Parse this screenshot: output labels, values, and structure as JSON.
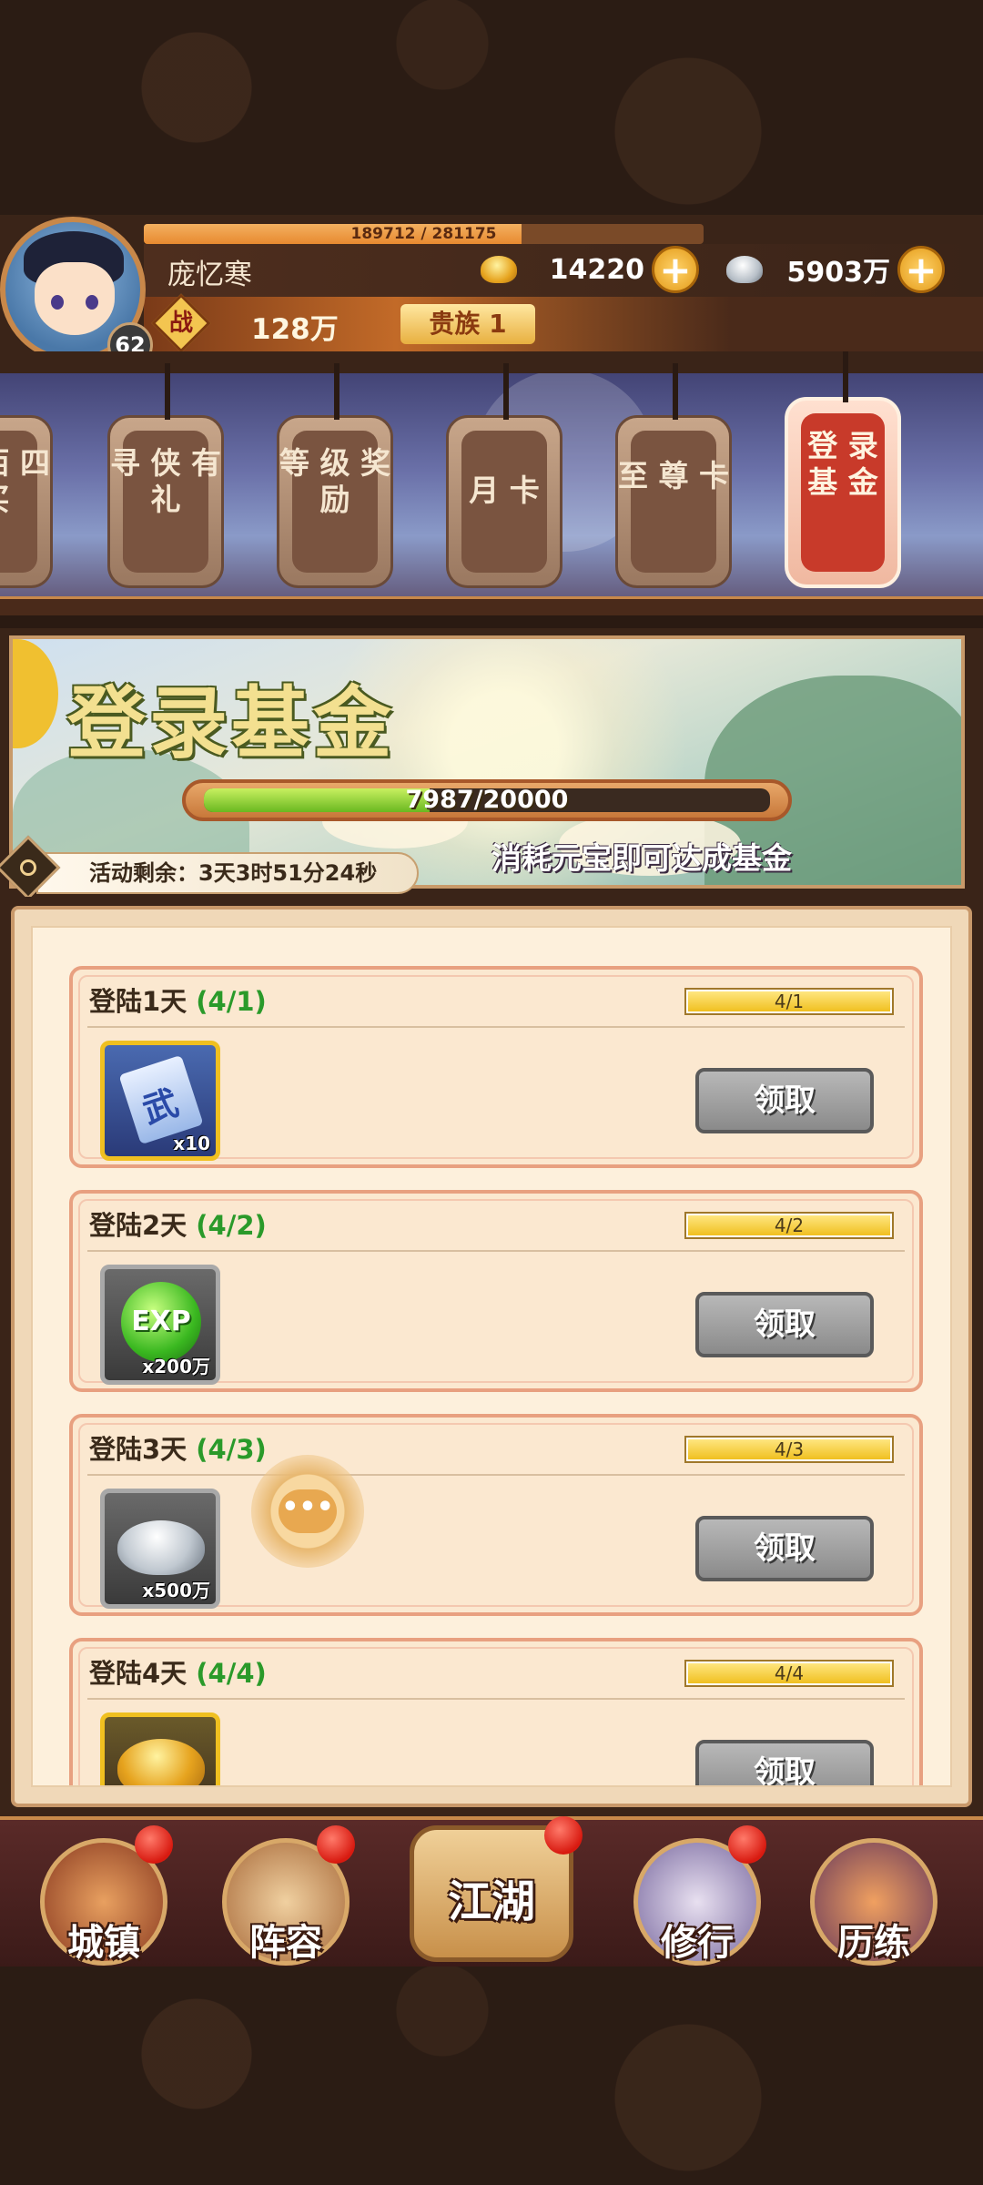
{
  "player": {
    "name": "庞忆寒",
    "level": "62",
    "exp_text": "189712 / 281175",
    "exp_fraction": 0.675,
    "war_label": "战",
    "power": "128万",
    "noble": "贵族 1"
  },
  "currency": {
    "gold": "14220",
    "silver": "5903万",
    "plus": "+"
  },
  "tabs": [
    {
      "label": "狠 西 四 买",
      "active": false
    },
    {
      "label": "寻 侠 有 礼",
      "active": false
    },
    {
      "label": "等 级 奖 励",
      "active": false
    },
    {
      "label": "月 卡",
      "active": false
    },
    {
      "label": "至 尊 卡",
      "active": false
    },
    {
      "label": "登 录 基 金",
      "active": true
    }
  ],
  "banner": {
    "title": "登录基金",
    "progress_text": "7987/20000",
    "progress_fraction": 0.399,
    "hint": "消耗元宝即可达成基金",
    "timer": "活动剩余：3天3时51分24秒"
  },
  "tasks": [
    {
      "title": "登陆1天",
      "count": "(4/1)",
      "bar_text": "4/1",
      "fill": 1.0,
      "reward_qty": "x10",
      "reward_icon": "skill-scroll-icon",
      "button": "领取"
    },
    {
      "title": "登陆2天",
      "count": "(4/2)",
      "bar_text": "4/2",
      "fill": 1.0,
      "reward_qty": "x200万",
      "reward_icon": "exp-orb-icon",
      "button": "领取"
    },
    {
      "title": "登陆3天",
      "count": "(4/3)",
      "bar_text": "4/3",
      "fill": 1.0,
      "reward_qty": "x500万",
      "reward_icon": "silver-ingot-icon",
      "button": "领取"
    },
    {
      "title": "登陆4天",
      "count": "(4/4)",
      "bar_text": "4/4",
      "fill": 1.0,
      "reward_qty": "",
      "reward_icon": "gold-ingot-icon",
      "button": "领取"
    }
  ],
  "chat": {
    "dots": "•••"
  },
  "nav": [
    {
      "label": "城镇",
      "badge": true
    },
    {
      "label": "阵容",
      "badge": true
    },
    {
      "label": "江湖",
      "badge": true
    },
    {
      "label": "修行",
      "badge": true
    },
    {
      "label": "历练",
      "badge": false
    }
  ],
  "colors": {
    "accent_gold": "#f0c020",
    "claim_grey": "#9a9a9a",
    "progress_green": "#6ab820",
    "task_count_green": "#2a9a2a",
    "red_badge": "#d81a10"
  }
}
